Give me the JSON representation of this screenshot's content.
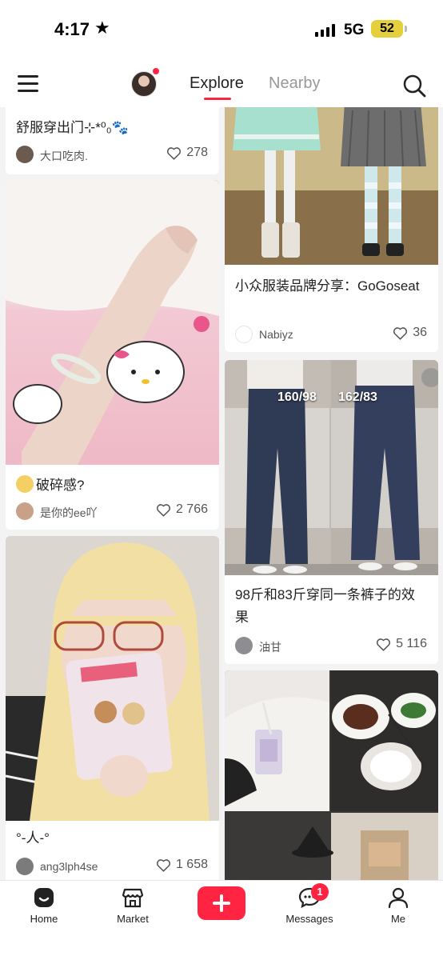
{
  "status_bar": {
    "time": "4:17",
    "network": "5G",
    "battery": "52",
    "colors": {
      "battery": "#e6cf3c"
    }
  },
  "top_nav": {
    "tabs": [
      {
        "label": "Explore",
        "active": true
      },
      {
        "label": "Nearby",
        "active": false
      }
    ],
    "accent_color": "#ff2442",
    "icons": [
      "menu-icon",
      "avatar",
      "search-icon"
    ]
  },
  "feed": {
    "left": [
      {
        "title": "舒服穿出门⊹*⁰₀🐾",
        "author": "大口吃肉.",
        "likes": "278"
      },
      {
        "title": "破碎感?",
        "author": "是你的ee吖",
        "likes": "2 766"
      },
      {
        "title": "°-人-°",
        "author": "ang3lph4se",
        "likes": "1 658"
      }
    ],
    "right": [
      {
        "title": "小众服装品牌分享：GoGoseat",
        "author": "Nabiyz",
        "likes": "36"
      },
      {
        "title": "98斤和83斤穿同一条裤子的效果",
        "author": "油甘",
        "likes": "5 116",
        "labels": [
          "160/98",
          "162/83"
        ]
      },
      {
        "title": "",
        "author": "",
        "likes": ""
      }
    ]
  },
  "bottom_bar": {
    "items": [
      {
        "label": "Home",
        "icon": "home-icon"
      },
      {
        "label": "Market",
        "icon": "market-icon"
      },
      {
        "label": "",
        "icon": "add-icon"
      },
      {
        "label": "Messages",
        "icon": "messages-icon",
        "badge": "1"
      },
      {
        "label": "Me",
        "icon": "profile-icon"
      }
    ]
  }
}
